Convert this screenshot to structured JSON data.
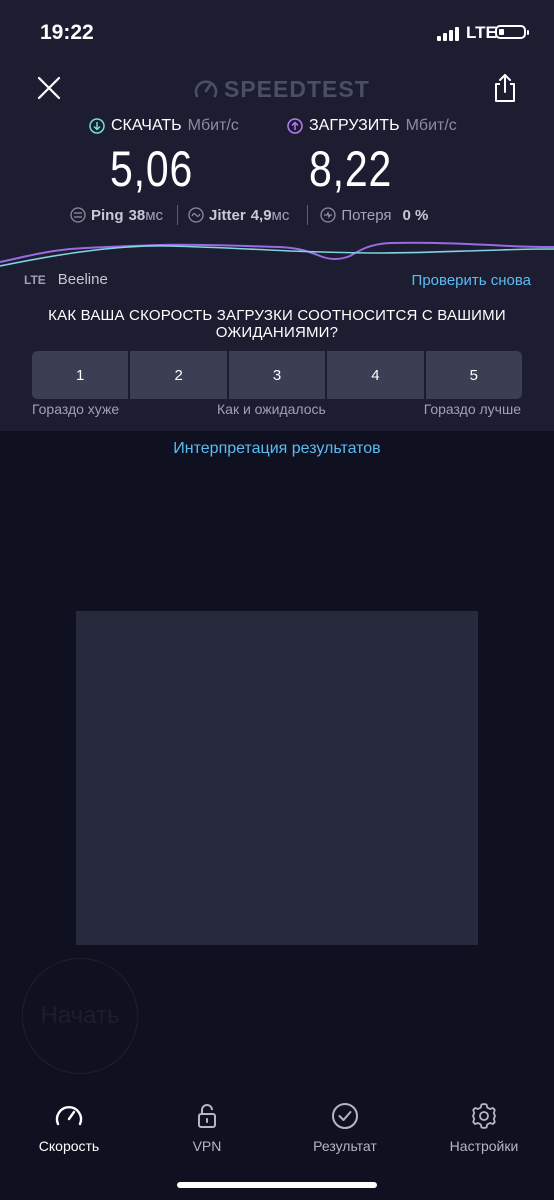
{
  "status_bar": {
    "time": "19:22",
    "network": "LTE"
  },
  "header": {
    "logo_text": "SPEEDTEST"
  },
  "download": {
    "label": "СКАЧАТЬ",
    "unit": "Мбит/с",
    "value": "5,06",
    "color": "#6fe0d8"
  },
  "upload": {
    "label": "ЗАГРУЗИТЬ",
    "unit": "Мбит/с",
    "value": "8,22",
    "color": "#b77cf5"
  },
  "stats": {
    "ping": {
      "label": "Ping",
      "value": "38",
      "unit": "мс"
    },
    "jitter": {
      "label": "Jitter",
      "value": "4,9",
      "unit": "мс"
    },
    "loss": {
      "label": "Потеря",
      "value": "0",
      "unit": "%"
    }
  },
  "provider": {
    "tech": "LTE",
    "isp": "Beeline",
    "retry": "Проверить снова"
  },
  "survey": {
    "question": "КАК ВАША СКОРОСТЬ ЗАГРУЗКИ СООТНОСИТСЯ С ВАШИМИ ОЖИДАНИЯМИ?",
    "options": [
      "1",
      "2",
      "3",
      "4",
      "5"
    ],
    "scale_left": "Гораздо хуже",
    "scale_mid": "Как и ожидалось",
    "scale_right": "Гораздо лучше"
  },
  "interpret_link": "Интерпретация результатов",
  "start_button": "Начать",
  "tabs": [
    {
      "label": "Скорость",
      "icon": "speedometer-icon",
      "active": true
    },
    {
      "label": "VPN",
      "icon": "unlock-icon",
      "active": false
    },
    {
      "label": "Результат",
      "icon": "check-circle-icon",
      "active": false
    },
    {
      "label": "Настройки",
      "icon": "gear-icon",
      "active": false
    }
  ],
  "colors": {
    "accent_link": "#5bbcf4",
    "panel_bg": "#1c1d31",
    "page_bg": "#0f1120"
  }
}
